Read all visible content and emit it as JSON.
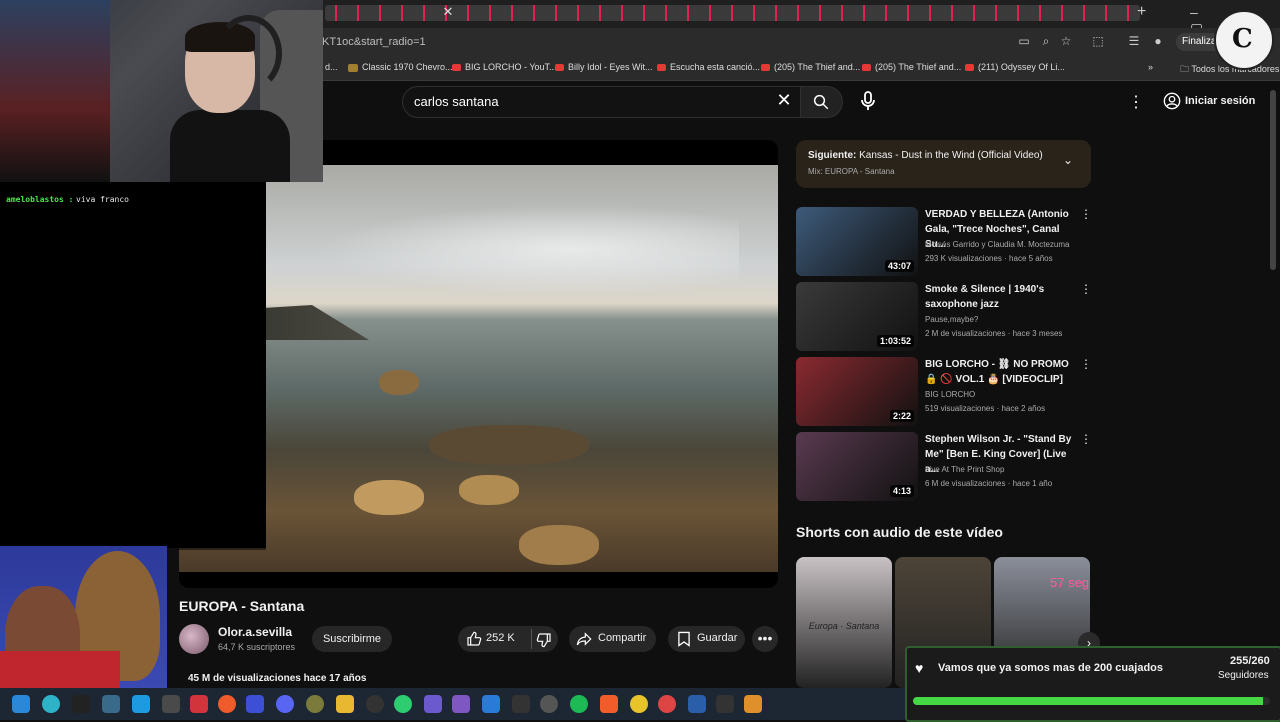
{
  "browser": {
    "url": "KT1oc&start_radio=1",
    "finalizar": "Finalizar a",
    "bookmarks": [
      "d...",
      "Classic 1970 Chevro...",
      "BIG LORCHO - YouT...",
      "Billy Idol - Eyes Wit...",
      "Escucha esta canció...",
      "(205) The Thief and...",
      "(205) The Thief and...",
      "(211) Odyssey Of Li..."
    ],
    "all_bookmarks": "Todos los marcadores"
  },
  "youtube": {
    "search_value": "carlos santana",
    "signin": "Iniciar sesión"
  },
  "chat": {
    "user": "ameloblastos :",
    "message": "viva franco"
  },
  "video": {
    "title": "EUROPA - Santana",
    "channel": "Olor.a.sevilla",
    "subscribers": "64,7 K suscriptores",
    "subscribe": "Suscribirme",
    "likes": "252 K",
    "share": "Compartir",
    "save": "Guardar",
    "views": "45 M de visualizaciones  hace 17 años"
  },
  "upnext": {
    "label": "Siguiente:",
    "title": "Kansas - Dust in the Wind (Official Video)",
    "mix": "Mix: EUROPA - Santana"
  },
  "related": [
    {
      "title": "VERDAD Y BELLEZA (Antonio Gala, \"Trece Noches\", Canal Su...",
      "channel": "Moisés Garrido y Claudia M. Moctezuma",
      "meta": "293 K visualizaciones · hace 5 años",
      "duration": "43:07",
      "color": "#3d5a7a"
    },
    {
      "title": "Smoke & Silence   |   1940's saxophone jazz",
      "channel": "Pause,maybe?",
      "meta": "2 M de visualizaciones · hace 3 meses",
      "duration": "1:03:52",
      "color": "#3a3a3a"
    },
    {
      "title": "BIG LORCHO - ⛓ NO PROMO 🔒 🚫 VOL.1 🎂 [VIDEOCLIP]",
      "channel": "BIG LORCHO",
      "meta": "519 visualizaciones · hace 2 años",
      "duration": "2:22",
      "color": "#8a2a30"
    },
    {
      "title": "Stephen Wilson Jr. - \"Stand By Me\" [Ben E. King Cover] (Live a...",
      "channel": "Live At The Print Shop",
      "meta": "6 M de visualizaciones · hace 1 año",
      "duration": "4:13",
      "color": "#5a3a50"
    }
  ],
  "shorts": {
    "heading": "Shorts con audio de este vídeo",
    "items": [
      {
        "overlay": "Europa · Santana",
        "color": "#c9c2c4"
      },
      {
        "overlay": "",
        "color": "#4d4438"
      },
      {
        "overlay": "57 seg",
        "color": "#8b8f9a"
      }
    ]
  },
  "alert": {
    "text": "Vamos que ya somos mas de 200 cuajados",
    "count": "255/260",
    "unit": "Seguidores",
    "progress": 0.98
  },
  "colors": {
    "accent_red": "#e53935",
    "progress_green": "#45d845"
  }
}
